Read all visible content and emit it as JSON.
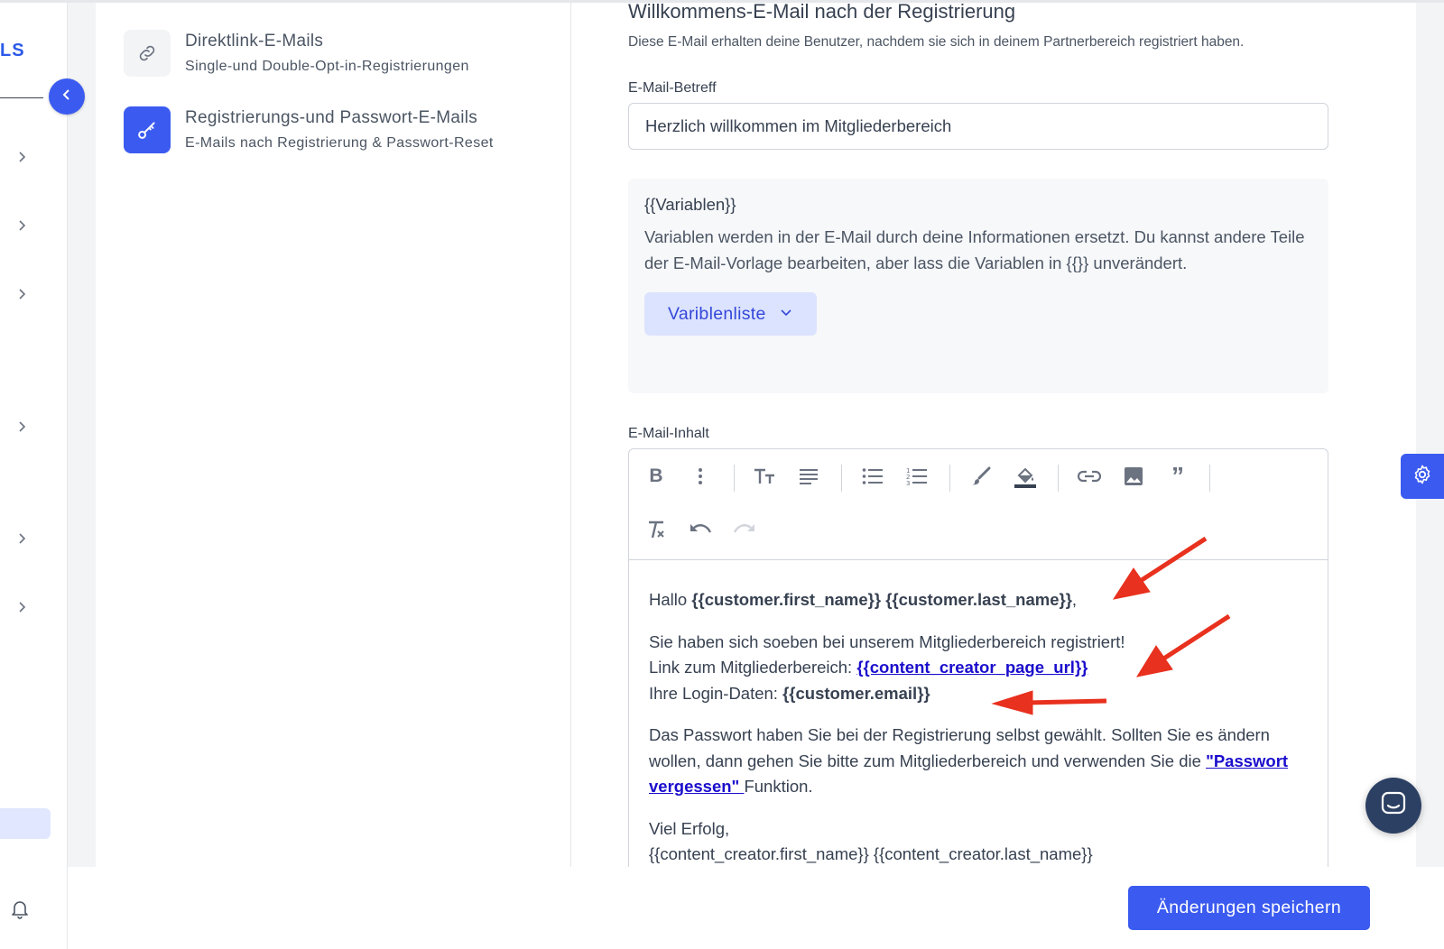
{
  "sidebar": {
    "brand_text": "LS"
  },
  "nav": {
    "items": [
      {
        "title": "Direktlink-E-Mails",
        "subtitle": "Single-und Double-Opt-in-Registrierungen",
        "icon": "link-icon",
        "active": false
      },
      {
        "title": "Registrierungs-und Passwort-E-Mails",
        "subtitle": "E-Mails nach Registrierung & Passwort-Reset",
        "icon": "key-icon",
        "active": true
      }
    ]
  },
  "section": {
    "title": "Willkommens-E-Mail nach der Registrierung",
    "description": "Diese E-Mail erhalten deine Benutzer, nachdem sie sich in deinem Partnerbereich registriert haben."
  },
  "subject": {
    "label": "E-Mail-Betreff",
    "value": "Herzlich willkommen im Mitgliederbereich"
  },
  "variables": {
    "title": "{{Variablen}}",
    "description": "Variablen werden in der E-Mail durch deine Informationen ersetzt. Du kannst andere Teile der E-Mail-Vorlage bearbeiten, aber lass die Variablen in {{}} unverändert.",
    "button_label": "Variblenliste"
  },
  "content": {
    "label": "E-Mail-Inhalt",
    "toolbar": [
      "bold-icon",
      "more-vertical-icon",
      "text-size-icon",
      "align-icon",
      "bullet-list-icon",
      "numbered-list-icon",
      "brush-icon",
      "fill-color-icon",
      "link-icon",
      "image-icon",
      "quote-icon",
      "clear-format-icon",
      "undo-icon",
      "redo-icon"
    ],
    "greeting_prefix": "Hallo ",
    "greeting_vars": "{{customer.first_name}} {{customer.last_name}}",
    "greeting_suffix": ",",
    "line1": "Sie haben sich soeben bei unserem Mitgliederbereich registriert!",
    "line2_prefix": "Link zum Mitgliederbereich: ",
    "line2_link": "{{content_creator_page_url}}",
    "line3_prefix": "Ihre Login-Daten: ",
    "line3_var": "{{customer.email}}",
    "para3_text": "Das Passwort haben Sie bei der Registrierung selbst gewählt. Sollten Sie es ändern wollen, dann gehen Sie bitte zum Mitgliederbereich und verwenden Sie die ",
    "para3_link": "\"Passwort vergessen\" ",
    "para3_suffix": "Funktion.",
    "closing": "Viel Erfolg,",
    "signature": "{{content_creator.first_name}} {{content_creator.last_name}}"
  },
  "footer": {
    "save_label": "Änderungen speichern"
  },
  "colors": {
    "accent": "#3b5bf0",
    "annotation_arrow": "#e8311e"
  }
}
